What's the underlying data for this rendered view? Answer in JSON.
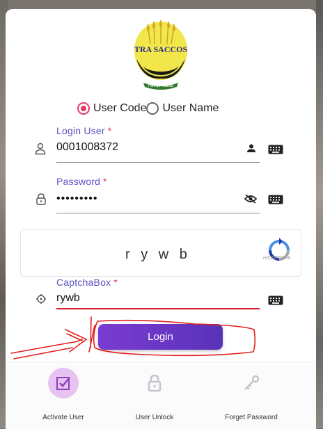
{
  "brand": {
    "logo_text": "TRA SACCOS",
    "logo_tagline": "Pamoja Tutafika"
  },
  "login_type": {
    "options": [
      {
        "label": "User Code",
        "selected": true
      },
      {
        "label": "User Name",
        "selected": false
      }
    ]
  },
  "fields": {
    "login_user": {
      "label": "Login User",
      "required_mark": "*",
      "value": "0001008372"
    },
    "password": {
      "label": "Password",
      "required_mark": "*",
      "value": "•••••••••"
    },
    "captcha_input": {
      "label": "CaptchaBox",
      "required_mark": "*",
      "value": "rywb"
    }
  },
  "captcha": {
    "text": "r y w b",
    "recaptcha_label": "reCAPTCHA"
  },
  "login_button": {
    "label": "Login"
  },
  "bottom_nav": [
    {
      "label": "Activate User",
      "icon": "checkbox-icon",
      "active": true
    },
    {
      "label": "User Unlock",
      "icon": "lock-icon",
      "active": false
    },
    {
      "label": "Forget Password",
      "icon": "key-icon",
      "active": false
    }
  ],
  "colors": {
    "accent": "#5b4fc4",
    "radio_selected": "#e53965",
    "error_underline": "#d11b2c",
    "button_start": "#7a3bd1",
    "button_end": "#5a32b9",
    "active_nav_bg": "#e7c3f1",
    "annotation_red": "#e0201c"
  }
}
